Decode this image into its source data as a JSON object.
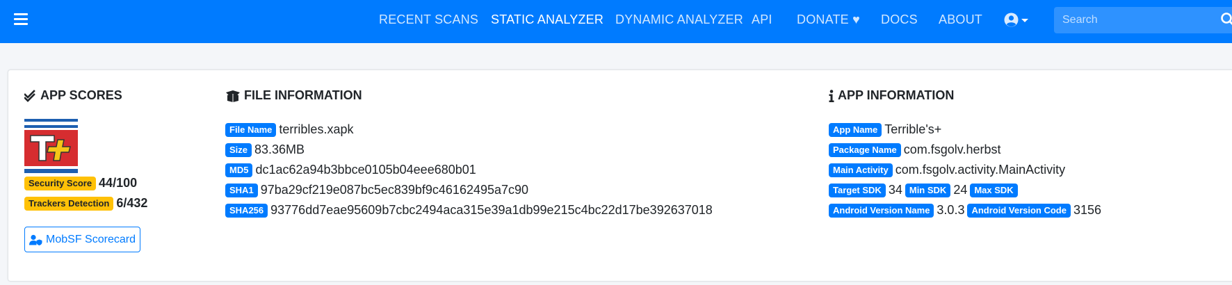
{
  "navbar": {
    "links": [
      {
        "label": "RECENT SCANS"
      },
      {
        "label": "STATIC ANALYZER"
      },
      {
        "label": "DYNAMIC ANALYZER"
      },
      {
        "label": "API"
      },
      {
        "label": "DONATE ♥"
      },
      {
        "label": "DOCS"
      },
      {
        "label": "ABOUT"
      }
    ],
    "active_link": "STATIC ANALYZER",
    "search_placeholder": "Search",
    "colors": {
      "primary": "#007bff"
    }
  },
  "app_scores": {
    "title": "APP SCORES",
    "security_score_label": "Security Score",
    "security_score_value": "44/100",
    "trackers_label": "Trackers Detection",
    "trackers_value": "6/432",
    "scorecard_button": "MobSF Scorecard"
  },
  "file_information": {
    "title": "FILE INFORMATION",
    "rows": [
      {
        "label": "File Name",
        "value": "terribles.xapk"
      },
      {
        "label": "Size",
        "value": "83.36MB"
      },
      {
        "label": "MD5",
        "value": "dc1ac62a94b3bbce0105b04eee680b01"
      },
      {
        "label": "SHA1",
        "value": "97ba29cf219e087bc5ec839bf9c46162495a7c90"
      },
      {
        "label": "SHA256",
        "value": "93776dd7eae95609b7cbc2494aca315e39a1db99e215c4bc22d17be392637018"
      }
    ]
  },
  "app_information": {
    "title": "APP INFORMATION",
    "app_name_label": "App Name",
    "app_name": "Terrible's+",
    "package_name_label": "Package Name",
    "package_name": "com.fsgolv.herbst",
    "main_activity_label": "Main Activity",
    "main_activity": "com.fsgolv.activity.MainActivity",
    "target_sdk_label": "Target SDK",
    "target_sdk": "34",
    "min_sdk_label": "Min SDK",
    "min_sdk": "24",
    "max_sdk_label": "Max SDK",
    "android_version_name_label": "Android Version Name",
    "android_version_name": "3.0.3",
    "android_version_code_label": "Android Version Code",
    "android_version_code": "3156"
  }
}
